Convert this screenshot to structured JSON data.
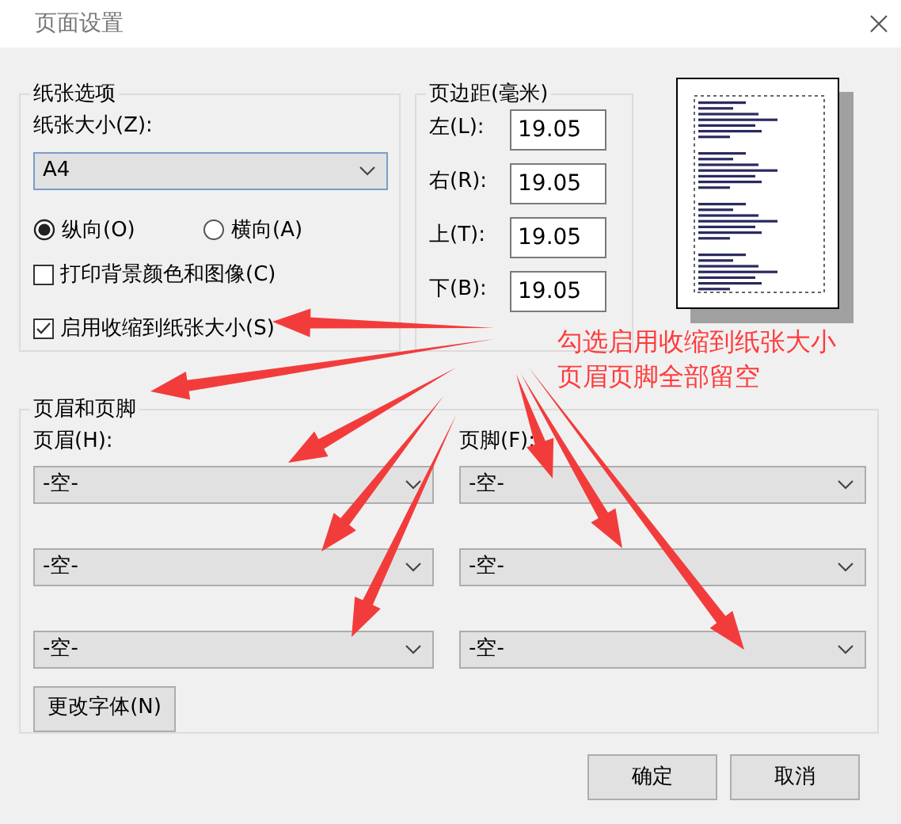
{
  "window": {
    "title": "页面设置"
  },
  "paper_options": {
    "legend": "纸张选项",
    "size_label": "纸张大小(Z):",
    "size_value": "A4",
    "orientations": [
      {
        "label": "纵向(O)",
        "selected": true
      },
      {
        "label": "横向(A)",
        "selected": false
      }
    ],
    "options": [
      {
        "label": "打印背景颜色和图像(C)",
        "checked": false
      },
      {
        "label": "启用收缩到纸张大小(S)",
        "checked": true
      }
    ]
  },
  "margins": {
    "legend": "页边距(毫米)",
    "fields": [
      {
        "label": "左(L):",
        "value": "19.05"
      },
      {
        "label": "右(R):",
        "value": "19.05"
      },
      {
        "label": "上(T):",
        "value": "19.05"
      },
      {
        "label": "下(B):",
        "value": "19.05"
      }
    ]
  },
  "header_footer": {
    "legend": "页眉和页脚",
    "header_label": "页眉(H):",
    "footer_label": "页脚(F):",
    "header": [
      "-空-",
      "-空-",
      "-空-"
    ],
    "footer": [
      "-空-",
      "-空-",
      "-空-"
    ],
    "font_button": "更改字体(N)"
  },
  "buttons": [
    "确定",
    "取消"
  ],
  "annotation": {
    "lines": [
      "勾选启用收缩到纸张大小",
      "页眉页脚全部留空"
    ]
  }
}
